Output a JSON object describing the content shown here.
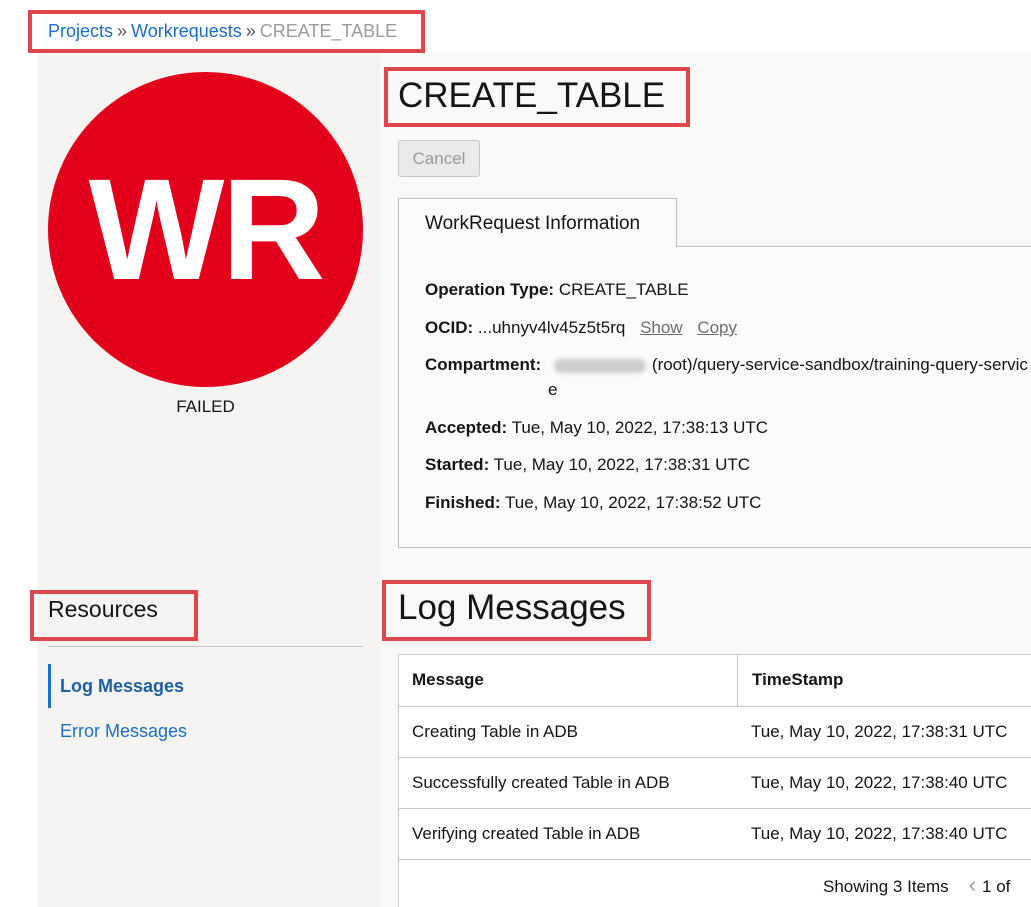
{
  "breadcrumb": {
    "projects": "Projects",
    "separator": "»",
    "workrequests": "Workrequests",
    "current": "CREATE_TABLE"
  },
  "avatar": {
    "initials": "WR",
    "status": "FAILED",
    "color": "#e3001b"
  },
  "page_title": "CREATE_TABLE",
  "cancel_label": "Cancel",
  "info_tab": "WorkRequest Information",
  "info": {
    "operation_type_label": "Operation Type:",
    "operation_type_value": "CREATE_TABLE",
    "ocid_label": "OCID:",
    "ocid_value": "...uhnyv4lv45z5t5rq",
    "show_label": "Show",
    "copy_label": "Copy",
    "compartment_label": "Compartment:",
    "compartment_value": "(root)/query-service-sandbox/training-query-servic",
    "compartment_wrap": "e",
    "accepted_label": "Accepted:",
    "accepted_value": "Tue, May 10, 2022, 17:38:13 UTC",
    "started_label": "Started:",
    "started_value": "Tue, May 10, 2022, 17:38:31 UTC",
    "finished_label": "Finished:",
    "finished_value": "Tue, May 10, 2022, 17:38:52 UTC"
  },
  "resources": {
    "title": "Resources",
    "items": [
      {
        "label": "Log Messages",
        "active": true
      },
      {
        "label": "Error Messages",
        "active": false
      }
    ]
  },
  "log_title": "Log Messages",
  "table": {
    "headers": [
      "Message",
      "TimeStamp"
    ],
    "rows": [
      {
        "message": "Creating Table in ADB",
        "timestamp": "Tue, May 10, 2022, 17:38:31 UTC"
      },
      {
        "message": "Successfully created Table in ADB",
        "timestamp": "Tue, May 10, 2022, 17:38:40 UTC"
      },
      {
        "message": "Verifying created Table in ADB",
        "timestamp": "Tue, May 10, 2022, 17:38:40 UTC"
      }
    ],
    "showing": "Showing 3 Items",
    "page": "1 of"
  },
  "colors": {
    "highlight": "#e0474c",
    "link": "#1c6fc7"
  }
}
